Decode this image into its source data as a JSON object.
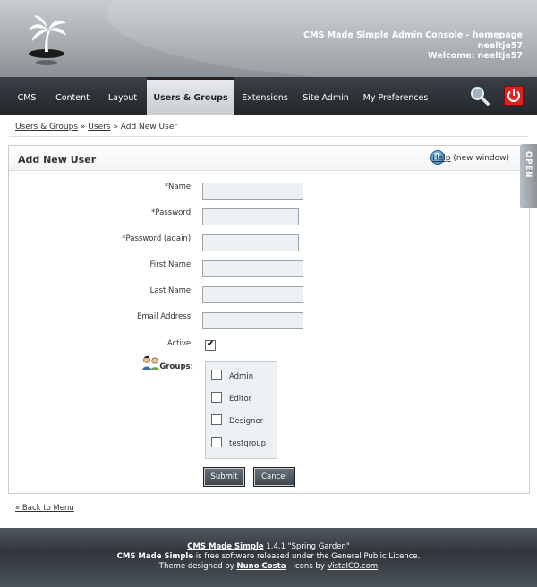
{
  "header": {
    "console_title": "CMS Made Simple Admin Console - homepage",
    "username": "neeltje57",
    "welcome": "Welcome: neeltje57"
  },
  "nav": {
    "tabs": [
      "CMS",
      "Content",
      "Layout",
      "Users & Groups",
      "Extensions",
      "Site Admin",
      "My Preferences"
    ],
    "active": "Users & Groups"
  },
  "breadcrumb": {
    "root": "Users & Groups",
    "sep1": "»",
    "users": "Users",
    "sep2": "»",
    "current": "Add New User"
  },
  "panel": {
    "title": "Add New User",
    "help_link": "Help",
    "help_note": "(new window)",
    "open_tab": "OPEN"
  },
  "form": {
    "name_label": "*Name:",
    "name_value": "",
    "password_label": "*Password:",
    "password_value": "",
    "password_again_label": "*Password (again):",
    "password_again_value": "",
    "first_name_label": "First Name:",
    "first_name_value": "",
    "last_name_label": "Last Name:",
    "last_name_value": "",
    "email_label": "Email Address:",
    "email_value": "",
    "active_label": "Active:",
    "active_checked": true,
    "groups_label": "Groups:",
    "groups": [
      {
        "label": "Admin",
        "checked": false
      },
      {
        "label": "Editor",
        "checked": false
      },
      {
        "label": "Designer",
        "checked": false
      },
      {
        "label": "testgroup",
        "checked": false
      }
    ],
    "submit": "Submit",
    "cancel": "Cancel"
  },
  "back_link": "« Back to Menu",
  "footer": {
    "product_link": "CMS Made Simple",
    "version": "1.4.1 \"Spring Garden\"",
    "license_brand": "CMS Made Simple",
    "license_text": "is free software released under the General Public Licence.",
    "theme_prefix": "Theme designed by",
    "theme_author": "Nuno Costa",
    "icons_prefix": "Icons by",
    "icons_author": "VistaICO.com"
  }
}
